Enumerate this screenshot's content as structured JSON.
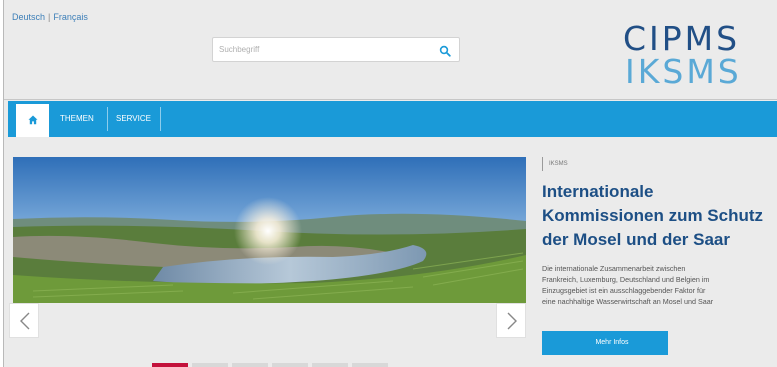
{
  "header": {
    "languages": [
      "Deutsch",
      "Français"
    ],
    "separator": "|",
    "search_placeholder": "Suchbegriff",
    "search_icon": "search-icon",
    "logo_line1": "CIPMS",
    "logo_line2": "IKSMS"
  },
  "nav": {
    "home_icon": "home-icon",
    "items": [
      {
        "label": "THEMEN"
      },
      {
        "label": "SERVICE"
      }
    ]
  },
  "feature": {
    "tag": "IKSMS",
    "title_lines": [
      "Internationale",
      "Kommissionen zum Schutz",
      "der Mosel und der Saar"
    ],
    "description_lines": [
      "Die internationale Zusammenarbeit zwischen",
      "Frankreich, Luxemburg, Deutschland und Belgien im",
      "Einzugsgebiet ist ein ausschlaggebender Faktor für",
      "eine nachhaltige Wasserwirtschaft an Mosel und Saar"
    ],
    "button_label": "Mehr Infos"
  },
  "slider": {
    "prev_icon": "chevron-left-icon",
    "next_icon": "chevron-right-icon",
    "slide_count": 6,
    "active_slide": 1
  },
  "colors": {
    "nav_blue": "#1a9ad8",
    "title_blue": "#1d4f85",
    "logo_dark": "#214f86",
    "logo_light": "#5aa9d6",
    "active_dot": "#c3113b"
  }
}
